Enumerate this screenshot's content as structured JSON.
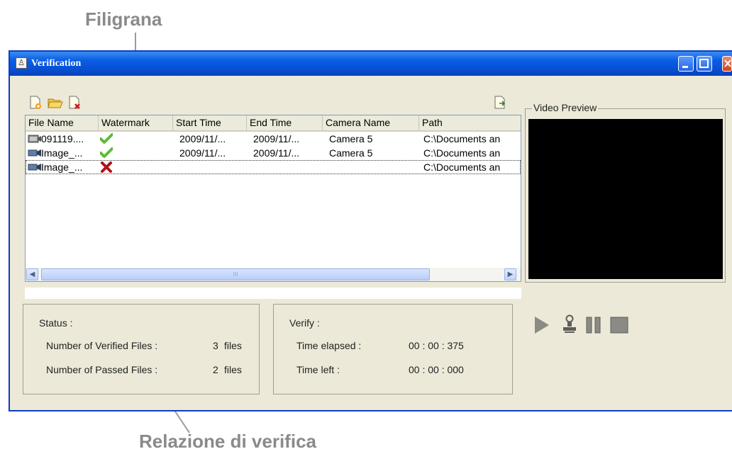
{
  "annotations": {
    "watermark_label": "Filigrana",
    "report_label": "Relazione di verifica"
  },
  "window": {
    "title": "Verification"
  },
  "file_list": {
    "columns": [
      "File Name",
      "Watermark",
      "Start Time",
      "End Time",
      "Camera Name",
      "Path"
    ],
    "rows": [
      {
        "file_name": "091119....",
        "watermark": "pass",
        "start_time": "2009/11/...",
        "end_time": "2009/11/...",
        "camera_name": "Camera 5",
        "path": "C:\\Documents an"
      },
      {
        "file_name": "Image_...",
        "watermark": "pass",
        "start_time": "2009/11/...",
        "end_time": "2009/11/...",
        "camera_name": "Camera 5",
        "path": "C:\\Documents an"
      },
      {
        "file_name": "Image_...",
        "watermark": "fail",
        "start_time": "",
        "end_time": "",
        "camera_name": "",
        "path": "C:\\Documents an"
      }
    ],
    "scroll_thumb_text": "III"
  },
  "status": {
    "heading": "Status :",
    "verified_label": "Number of Verified Files :",
    "verified_count": "3",
    "verified_unit": "files",
    "passed_label": "Number of Passed Files :",
    "passed_count": "2",
    "passed_unit": "files"
  },
  "verify": {
    "heading": "Verify :",
    "elapsed_label": "Time elapsed :",
    "elapsed_value": "00 : 00 : 375",
    "left_label": "Time left :",
    "left_value": "00 : 00 : 000"
  },
  "video_preview": {
    "label": "Video Preview"
  },
  "icons": [
    "add-file-icon",
    "open-folder-icon",
    "remove-file-icon",
    "export-report-icon",
    "play-icon",
    "stamp-icon",
    "pause-icon",
    "stop-icon",
    "checkmark-icon",
    "cross-icon",
    "video-file-icon"
  ],
  "colors": {
    "titlebar": "#0a5ee4",
    "window_bg": "#ece9d8",
    "check": "#5dbb3a",
    "cross": "#b0121b",
    "callout_text": "#8a8a8a"
  }
}
